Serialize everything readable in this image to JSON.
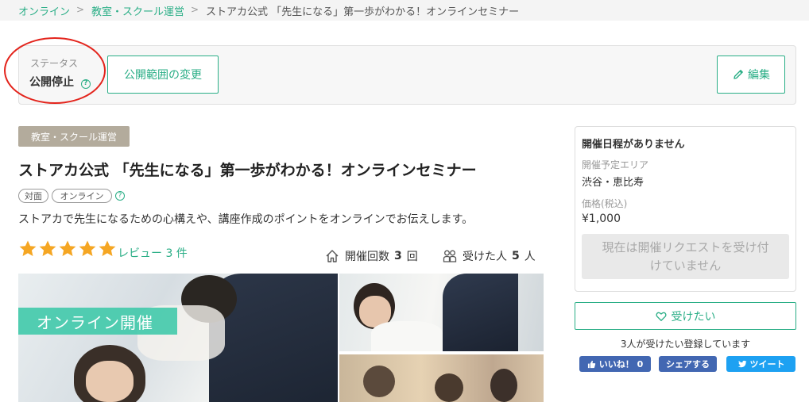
{
  "breadcrumb": {
    "items": [
      "オンライン",
      "教室・スクール運営",
      "ストアカ公式 「先生になる」第一歩がわかる！オンラインセミナー"
    ],
    "separator": ">"
  },
  "status": {
    "label": "ステータス",
    "value": "公開停止",
    "help": "?",
    "change_visibility_button": "公開範囲の変更",
    "edit_button": "編集"
  },
  "course": {
    "category": "教室・スクール運営",
    "title": "ストアカ公式 「先生になる」第一歩がわかる！オンラインセミナー",
    "formats": [
      "対面",
      "オンライン"
    ],
    "format_help": "?",
    "description": "ストアカで先生になるための心構えや、講座作成のポイントをオンラインでお伝えします。",
    "rating": 5,
    "rating_max": 5,
    "review_label": "レビュー 3 件",
    "held": {
      "label": "開催回数",
      "count": "3",
      "unit": "回"
    },
    "attendees": {
      "label": "受けた人",
      "count": "5",
      "unit": "人"
    },
    "photo_banner": "オンライン開催"
  },
  "sidebar": {
    "schedule_status": "開催日程がありません",
    "area_label": "開催予定エリア",
    "area_value": "渋谷・恵比寿",
    "price_label": "価格(税込)",
    "price_value": "¥1,000",
    "request_button_line1": "現在は開催リクエストを受け付",
    "request_button_line2": "けていません",
    "want_button": "受けたい",
    "want_count_text": "3人が受けたい登録しています"
  },
  "social": {
    "like_label": "いいね！ 0",
    "share_label": "シェアする",
    "tweet_label": "ツイート"
  },
  "colors": {
    "accent": "#2aae86",
    "star": "#f5a623",
    "highlight_circle": "#e3241c",
    "facebook": "#4267b2",
    "twitter": "#1da1f2"
  },
  "icons": [
    "help-icon",
    "pencil-icon",
    "star-icon",
    "house-icon",
    "people-icon",
    "heart-icon",
    "thumbs-up-icon",
    "twitter-bird-icon"
  ]
}
